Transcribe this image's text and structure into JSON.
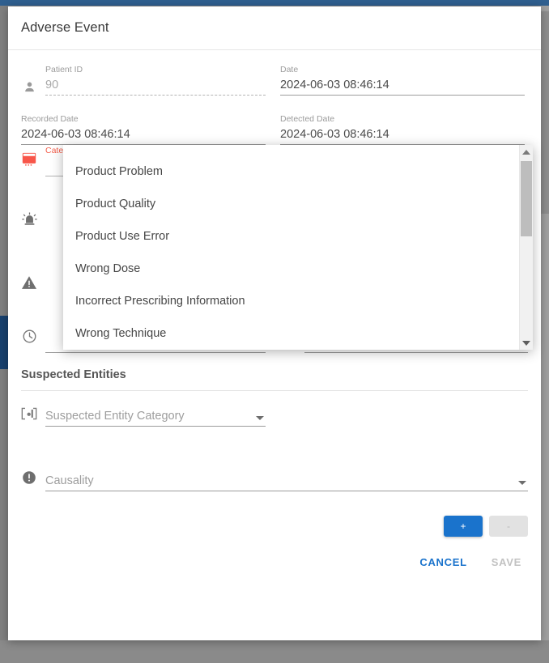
{
  "window": {
    "accent_blue": "#1a73cc",
    "error_red": "#f4604d",
    "titlebar_color": "#2f5f8f"
  },
  "dialog": {
    "title": "Adverse Event"
  },
  "form": {
    "patient_id": {
      "icon": "person-icon",
      "label": "Patient ID",
      "value": "90",
      "disabled": true
    },
    "date": {
      "label": "Date",
      "value": "2024-06-03 08:46:14"
    },
    "recorded_date": {
      "label": "Recorded Date",
      "value": "2024-06-03 08:46:14"
    },
    "detected_date": {
      "label": "Detected Date",
      "value": "2024-06-03 08:46:14"
    },
    "category": {
      "icon": "list-box-icon",
      "label": "Category",
      "value": "",
      "error": true
    },
    "seriousness": {
      "icon": "alarm-icon",
      "label": "",
      "value": ""
    },
    "severity": {
      "icon": "warning-triangle-icon",
      "label": "",
      "value": ""
    },
    "onset": {
      "icon": "clock-icon",
      "label": "",
      "value": ""
    }
  },
  "suspected_entities": {
    "heading": "Suspected Entities",
    "entity_category": {
      "icon": "device-icon",
      "placeholder": "Suspected Entity Category",
      "value": ""
    }
  },
  "causality": {
    "icon": "exclamation-circle-icon",
    "placeholder": "Causality",
    "value": ""
  },
  "dropdown": {
    "open": true,
    "options": [
      "Product Problem",
      "Product Quality",
      "Product Use Error",
      "Wrong Dose",
      "Incorrect Prescribing Information",
      "Wrong Technique"
    ],
    "scroll_up_icon": "scroll-up-arrow-icon",
    "scroll_down_icon": "scroll-down-arrow-icon"
  },
  "buttons": {
    "add_label": "+",
    "remove_label": "-",
    "cancel_label": "CANCEL",
    "save_label": "SAVE",
    "save_disabled": true,
    "remove_disabled": true
  }
}
